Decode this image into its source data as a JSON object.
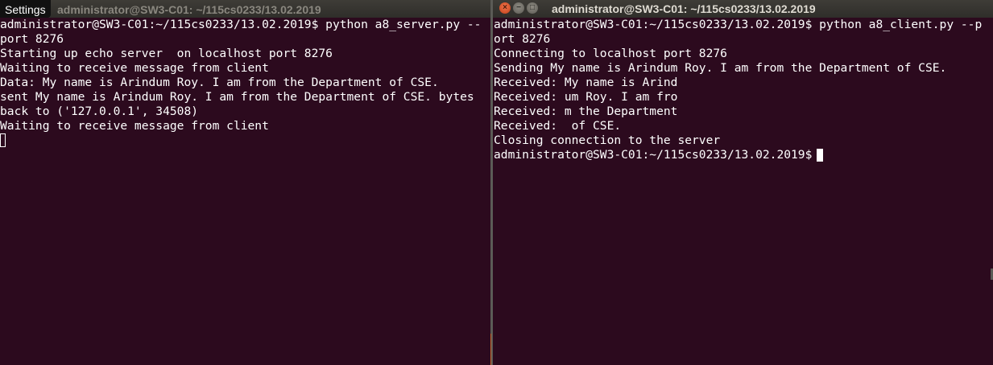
{
  "settings_menu": "Settings",
  "left_window": {
    "title": "administrator@SW3-C01: ~/115cs0233/13.02.2019",
    "lines": [
      "administrator@SW3-C01:~/115cs0233/13.02.2019$ python a8_server.py --",
      "port 8276",
      "Starting up echo server  on localhost port 8276",
      "Waiting to receive message from client",
      "Data: My name is Arindum Roy. I am from the Department of CSE.",
      "sent My name is Arindum Roy. I am from the Department of CSE. bytes",
      "back to ('127.0.0.1', 34508)",
      "Waiting to receive message from client"
    ]
  },
  "right_window": {
    "title": "administrator@SW3-C01: ~/115cs0233/13.02.2019",
    "buttons": {
      "close": "×",
      "minimize": "−",
      "maximize": "□"
    },
    "lines": [
      "administrator@SW3-C01:~/115cs0233/13.02.2019$ python a8_client.py --p",
      "ort 8276",
      "Connecting to localhost port 8276",
      "Sending My name is Arindum Roy. I am from the Department of CSE.",
      "Received: My name is Arind",
      "Received: um Roy. I am fro",
      "Received: m the Department",
      "Received:  of CSE.",
      "Closing connection to the server"
    ],
    "prompt": "administrator@SW3-C01:~/115cs0233/13.02.2019$"
  }
}
